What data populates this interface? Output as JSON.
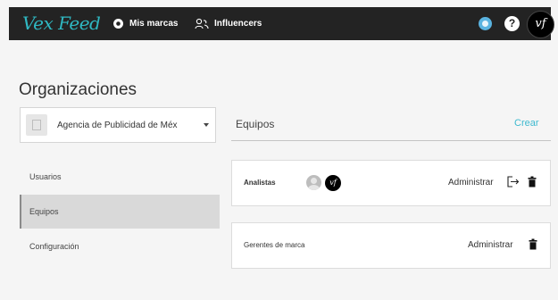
{
  "header": {
    "logo": "Vex Feed",
    "nav": [
      {
        "label": "Mis marcas",
        "icon": "brand-circle-icon"
      },
      {
        "label": "Influencers",
        "icon": "users-icon"
      }
    ],
    "help_label": "?",
    "avatar_initials": "vf"
  },
  "page": {
    "title": "Organizaciones"
  },
  "org_select": {
    "value": "Agencia de Publicidad de Méx"
  },
  "sidebar": {
    "items": [
      {
        "label": "Usuarios",
        "active": false
      },
      {
        "label": "Equipos",
        "active": true
      },
      {
        "label": "Configuración",
        "active": false
      }
    ]
  },
  "teams_section": {
    "title": "Equipos",
    "create_label": "Crear",
    "teams": [
      {
        "name": "Analistas",
        "members": [
          "member-photo",
          "vf"
        ],
        "admin_label": "Administrar",
        "icons": [
          "leave-icon",
          "trash-icon"
        ]
      },
      {
        "name": "Gerentes de marca",
        "members": [],
        "admin_label": "Administrar",
        "icons": [
          "trash-icon"
        ]
      }
    ]
  },
  "colors": {
    "topbar": "#232323",
    "logo": "#2fb8c2",
    "accent": "#3db9cf",
    "notification": "#5ab3e0",
    "active_item_bg": "#d9d9d9"
  }
}
